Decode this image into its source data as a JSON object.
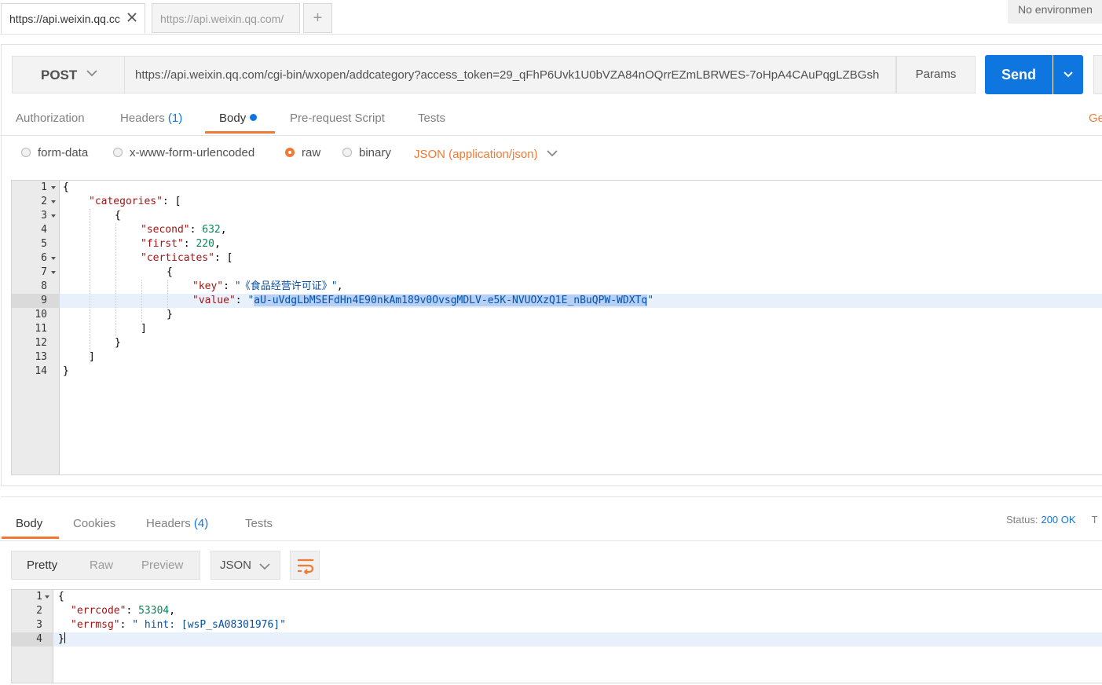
{
  "tabs": [
    {
      "label": "https://api.weixin.qq.cc",
      "active": true
    },
    {
      "label": "https://api.weixin.qq.com/",
      "active": false
    }
  ],
  "new_tab_label": "+",
  "environment": "No environmen",
  "request": {
    "method": "POST",
    "url": "https://api.weixin.qq.com/cgi-bin/wxopen/addcategory?access_token=29_qFhP6Uvk1U0bVZA84nOQrrEZmLBRWES-7oHpA4CAuPqgLZBGsh",
    "params_label": "Params",
    "send_label": "Send",
    "tabs": {
      "authorization": "Authorization",
      "headers": "Headers",
      "headers_count": "(1)",
      "body": "Body",
      "prerequest": "Pre-request Script",
      "tests": "Tests",
      "generate": "Ge"
    },
    "body_modes": {
      "form_data": "form-data",
      "urlencoded": "x-www-form-urlencoded",
      "raw": "raw",
      "binary": "binary",
      "selected": "raw"
    },
    "content_type": "JSON (application/json)",
    "editor": {
      "line_numbers": [
        "1",
        "2",
        "3",
        "4",
        "5",
        "6",
        "7",
        "8",
        "9",
        "10",
        "11",
        "12",
        "13",
        "14"
      ],
      "selected_line": "9",
      "lines": [
        {
          "p": "{"
        },
        {
          "k": "\"categories\"",
          "p": ": ["
        },
        {
          "p": "{"
        },
        {
          "k": "\"second\"",
          "p": ": ",
          "n": "632",
          "p2": ","
        },
        {
          "k": "\"first\"",
          "p": ": ",
          "n": "220",
          "p2": ","
        },
        {
          "k": "\"certicates\"",
          "p": ": ["
        },
        {
          "p": "{"
        },
        {
          "k": "\"key\"",
          "p": ": ",
          "s": "\"《食品经营许可证》\"",
          "p2": ","
        },
        {
          "k": "\"value\"",
          "p": ": ",
          "s_open": "\"",
          "s_sel": "aU-uVdgLbMSEFdHn4E90nkAm189v0OvsgMDLV-e5K-NVUOXzQ1E_nBuQPW-WDXTq",
          "s_close": "\""
        },
        {
          "p": "}"
        },
        {
          "p": "]"
        },
        {
          "p": "}"
        },
        {
          "p": "]"
        },
        {
          "p": "}"
        }
      ]
    }
  },
  "response": {
    "tabs": {
      "body": "Body",
      "cookies": "Cookies",
      "headers": "Headers",
      "headers_count": "(4)",
      "tests": "Tests"
    },
    "status_label": "Status:",
    "status_value": "200 OK",
    "time_label": "T",
    "view_modes": {
      "pretty": "Pretty",
      "raw": "Raw",
      "preview": "Preview",
      "selected": "Pretty"
    },
    "format": "JSON",
    "editor": {
      "line_numbers": [
        "1",
        "2",
        "3",
        "4"
      ],
      "selected_line": "4",
      "lines": [
        {
          "p": "{"
        },
        {
          "k": "\"errcode\"",
          "p": ": ",
          "n": "53304",
          "p2": ","
        },
        {
          "k": "\"errmsg\"",
          "p": ": ",
          "s": "\" hint: [wsP_sA08301976]\""
        },
        {
          "p": "}"
        }
      ]
    }
  },
  "colors": {
    "accent_orange": "#f07a35",
    "accent_blue": "#0f76e0",
    "json_key": "#a31515",
    "json_string": "#0451a5",
    "json_number": "#098658"
  },
  "icons": {
    "tab_close": "close-icon",
    "method_dropdown": "chevron-down-icon",
    "send_dropdown": "chevron-down-icon",
    "content_type_dropdown": "chevron-down-icon",
    "wrap_toggle": "wrap-lines-icon"
  }
}
